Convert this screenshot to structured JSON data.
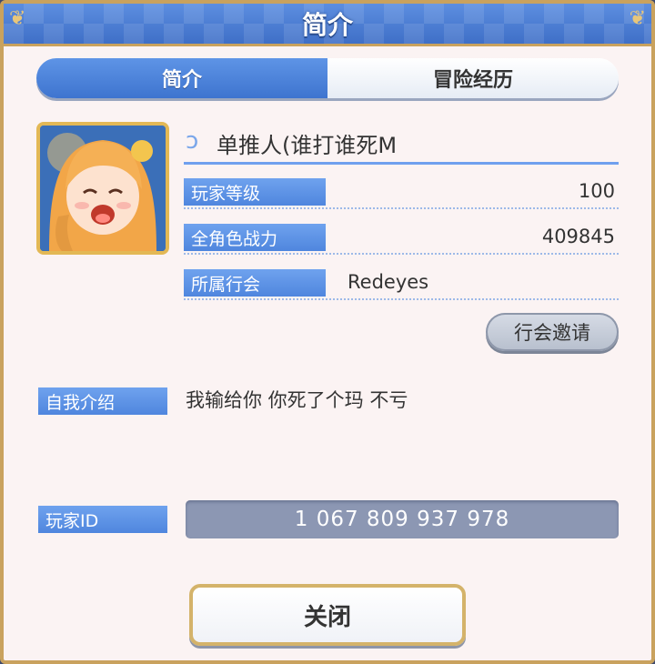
{
  "dialog": {
    "title": "简介"
  },
  "tabs": [
    {
      "label": "简介",
      "active": true
    },
    {
      "label": "冒险经历",
      "active": false
    }
  ],
  "player": {
    "name": "单推人(谁打谁死M",
    "avatar_icon": "character-portrait",
    "stats": [
      {
        "label": "玩家等级",
        "value": "100"
      },
      {
        "label": "全角色战力",
        "value": "409845"
      },
      {
        "label": "所属行会",
        "value": "Redeyes"
      }
    ]
  },
  "guild_invite_label": "行会邀请",
  "bio": {
    "label": "自我介绍",
    "text": "我输给你 你死了个玛 不亏"
  },
  "player_id": {
    "label": "玩家ID",
    "value": "1 067 809 937 978"
  },
  "close_label": "关闭",
  "colors": {
    "header": "#4f80d6",
    "accent": "#5b8fe3",
    "gold": "#c9a25e",
    "panel": "#fbf3f3"
  }
}
